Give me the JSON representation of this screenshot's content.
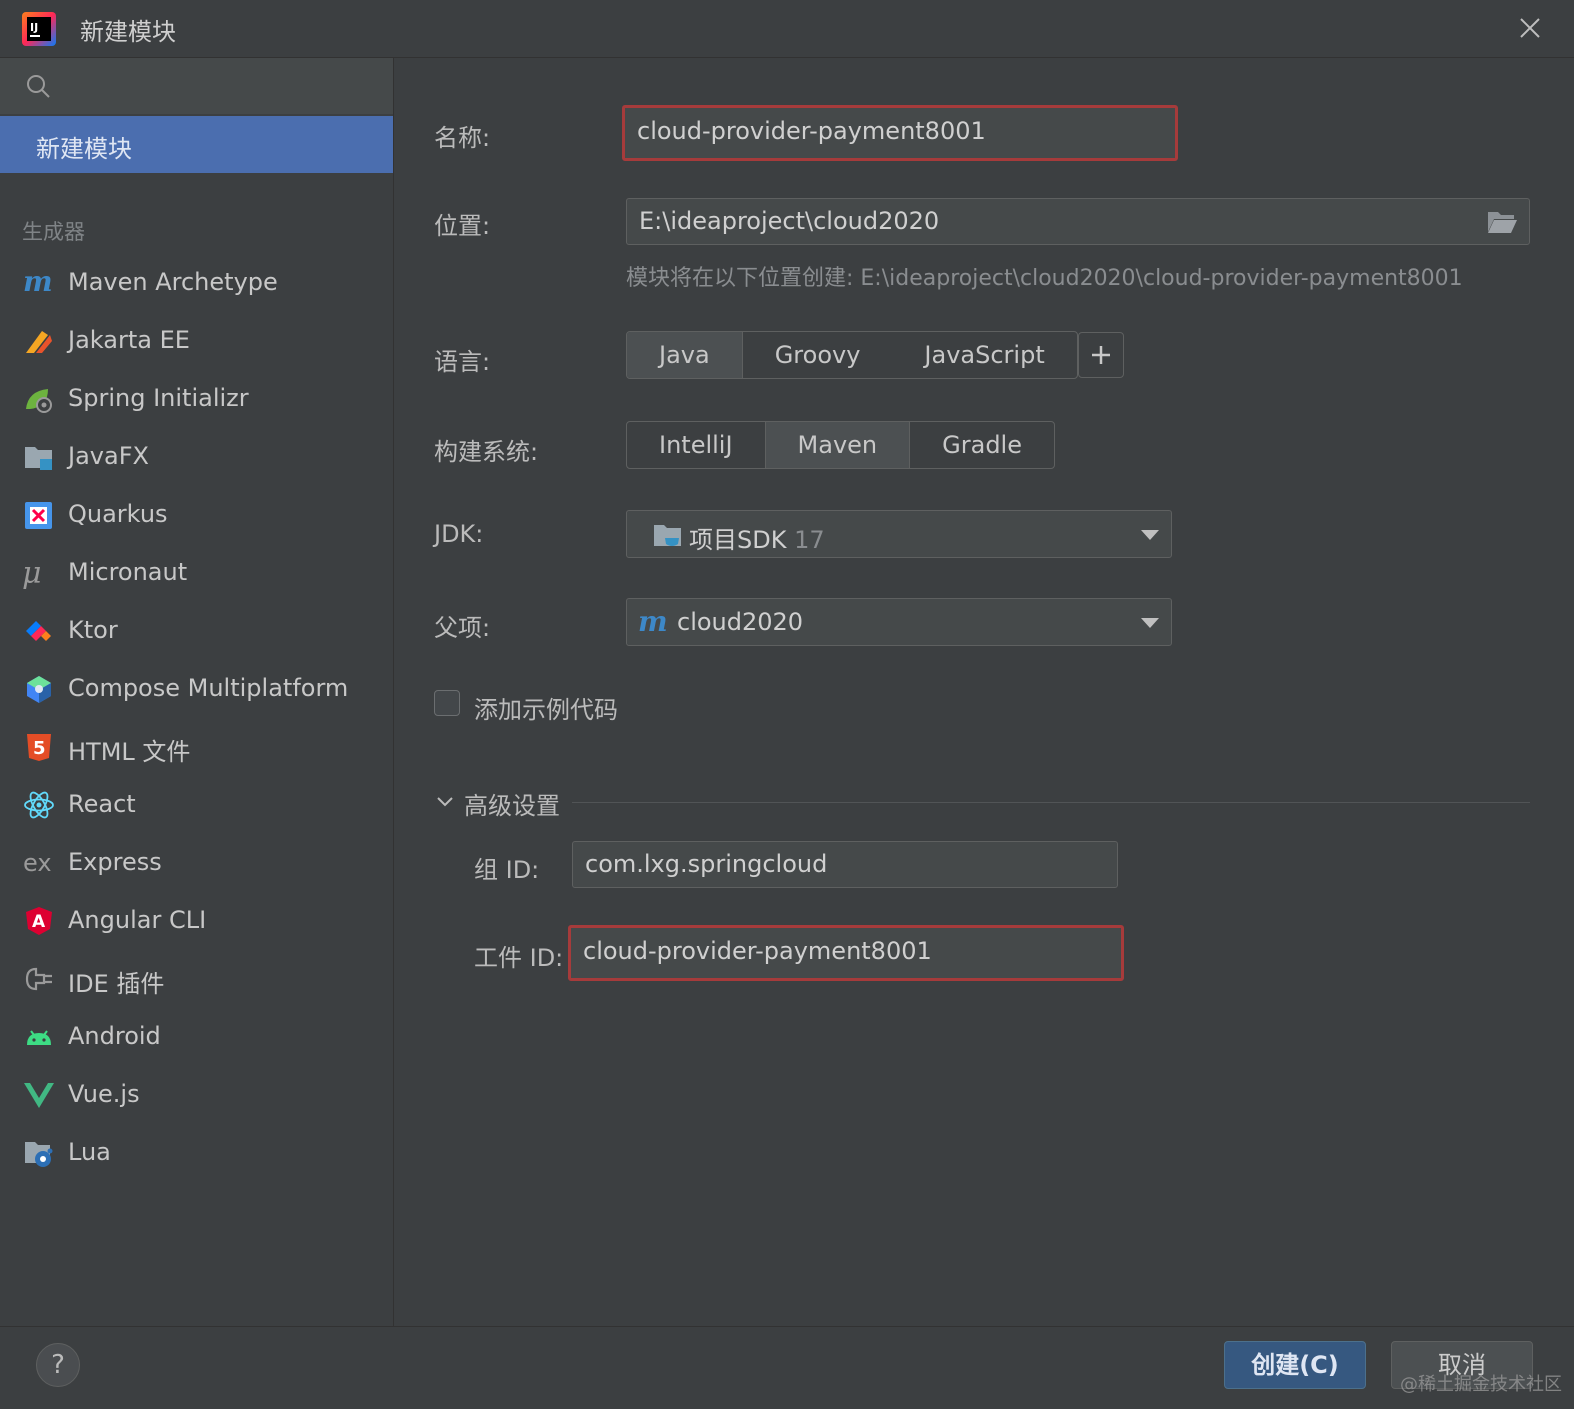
{
  "window": {
    "title": "新建模块",
    "logo_icon": "intellij-idea-icon",
    "close_icon": "close-icon"
  },
  "sidebar": {
    "search": {
      "placeholder": ""
    },
    "selected_item": "新建模块",
    "section_label": "生成器",
    "generators": [
      {
        "label": "Maven Archetype",
        "icon": "maven-icon"
      },
      {
        "label": "Jakarta EE",
        "icon": "jakarta-ee-icon"
      },
      {
        "label": "Spring Initializr",
        "icon": "spring-icon"
      },
      {
        "label": "JavaFX",
        "icon": "javafx-icon"
      },
      {
        "label": "Quarkus",
        "icon": "quarkus-icon"
      },
      {
        "label": "Micronaut",
        "icon": "micronaut-icon"
      },
      {
        "label": "Ktor",
        "icon": "ktor-icon"
      },
      {
        "label": "Compose Multiplatform",
        "icon": "compose-icon"
      },
      {
        "label": "HTML 文件",
        "icon": "html5-icon"
      },
      {
        "label": "React",
        "icon": "react-icon"
      },
      {
        "label": "Express",
        "icon": "express-icon"
      },
      {
        "label": "Angular CLI",
        "icon": "angular-icon"
      },
      {
        "label": "IDE 插件",
        "icon": "plugin-icon"
      },
      {
        "label": "Android",
        "icon": "android-icon"
      },
      {
        "label": "Vue.js",
        "icon": "vue-icon"
      },
      {
        "label": "Lua",
        "icon": "lua-icon"
      }
    ]
  },
  "form": {
    "name_label": "名称:",
    "name_value": "cloud-provider-payment8001",
    "location_label": "位置:",
    "location_value": "E:\\ideaproject\\cloud2020",
    "location_hint": "模块将在以下位置创建: E:\\ideaproject\\cloud2020\\cloud-provider-payment8001",
    "language_label": "语言:",
    "languages": [
      "Java",
      "Groovy",
      "JavaScript"
    ],
    "language_selected": "Java",
    "build_label": "构建系统:",
    "build_systems": [
      "IntelliJ",
      "Maven",
      "Gradle"
    ],
    "build_selected": "Maven",
    "jdk_label": "JDK:",
    "jdk_value": "项目SDK",
    "jdk_version": "17",
    "parent_label": "父项:",
    "parent_value": "cloud2020",
    "sample_code_label": "添加示例代码",
    "sample_code_checked": false,
    "advanced_label": "高级设置",
    "group_id_label": "组 ID:",
    "group_id_value": "com.lxg.springcloud",
    "artifact_id_label": "工件 ID:",
    "artifact_id_value": "cloud-provider-payment8001"
  },
  "footer": {
    "help_label": "?",
    "create_label": "创建(C)",
    "cancel_label": "取消"
  },
  "watermark": "@稀土掘金技术社区",
  "colors": {
    "background": "#3c3f41",
    "selection": "#4b6eaf",
    "primary_button": "#365880",
    "error_border": "#a63b3b"
  }
}
